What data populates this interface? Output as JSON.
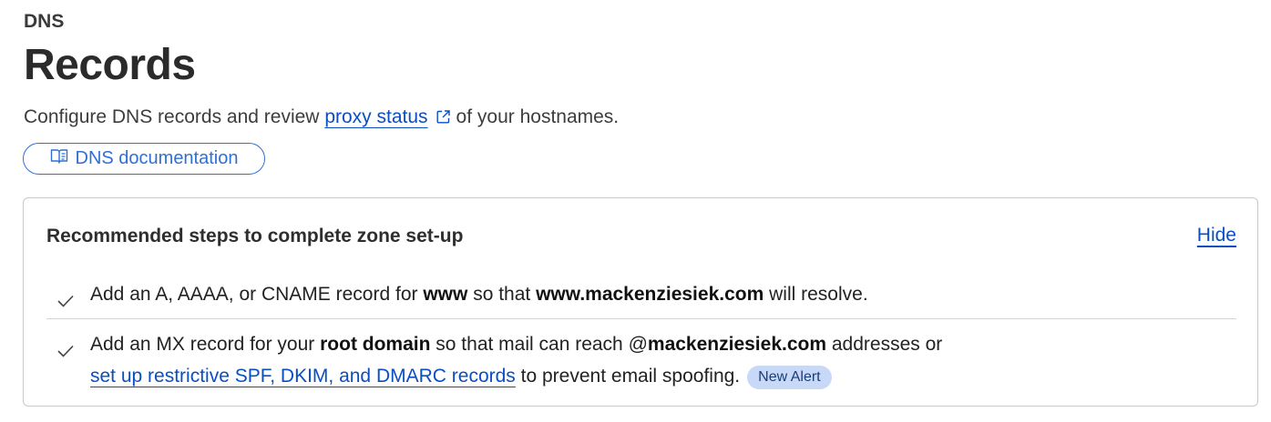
{
  "header": {
    "section": "DNS",
    "title": "Records",
    "description_before": "Configure DNS records and review",
    "description_link": "proxy status",
    "description_after": "of your hostnames.",
    "doc_button": "DNS documentation"
  },
  "recommended": {
    "title": "Recommended steps to complete zone set-up",
    "hide_label": "Hide",
    "step1": {
      "t1": "Add an A, AAAA, or CNAME record for",
      "b1": "www",
      "t2": "so that",
      "b2": "www.mackenziesiek.com",
      "t3": "will resolve."
    },
    "step2": {
      "t1": "Add an MX record for your",
      "b1": "root domain",
      "t2": "so that mail can reach @",
      "b2": "mackenziesiek.com",
      "t3": "addresses or",
      "link": "set up restrictive SPF, DKIM, and DMARC records",
      "t4": "to prevent email spoofing.",
      "badge": "New Alert"
    }
  },
  "colors": {
    "link": "#0b4ec2",
    "button_accent": "#2f6fd6",
    "badge_bg": "#c8d9f7"
  },
  "icons": [
    "external-link-icon",
    "book-icon",
    "check-icon"
  ]
}
